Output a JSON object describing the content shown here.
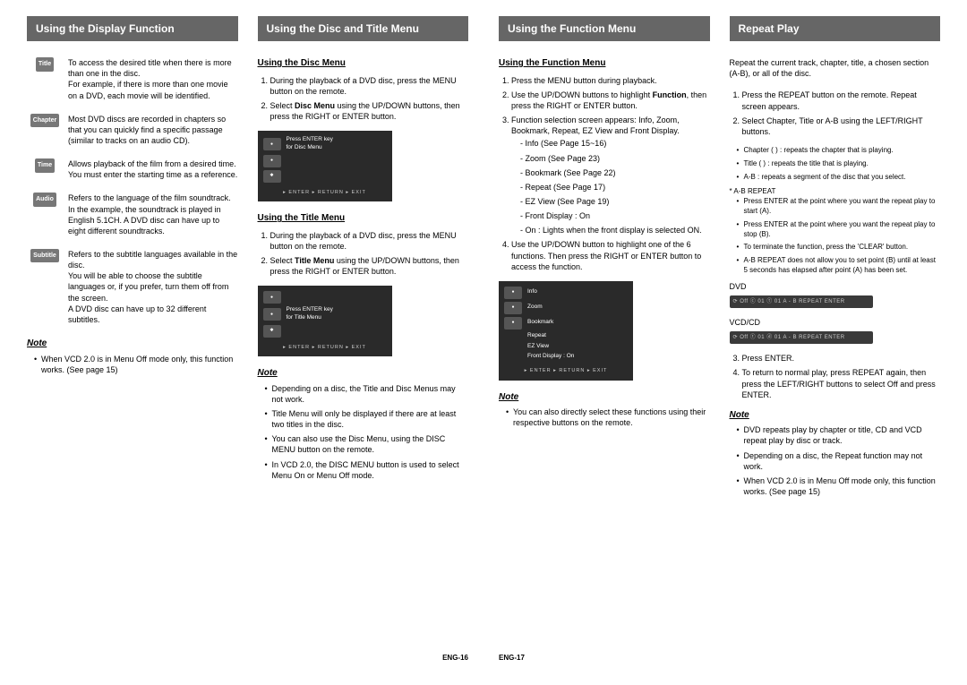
{
  "left_page": {
    "num": "ENG-16",
    "col1": {
      "title": "Using the Display Function",
      "defs": [
        {
          "icon": "Title",
          "text": "To access the desired title when there is more than one in the disc.\nFor example, if there is more than one movie on a DVD, each movie will be identified."
        },
        {
          "icon": "Chapter",
          "text": "Most DVD discs are recorded in chapters so that you can quickly find a specific passage (similar to tracks on an audio CD)."
        },
        {
          "icon": "Time",
          "text": "Allows playback of the film from a desired time. You must enter the starting time as a reference."
        },
        {
          "icon": "Audio",
          "text": "Refers to the language of the film soundtrack. In the example, the soundtrack is played in English 5.1CH. A DVD disc can have up to eight different soundtracks."
        },
        {
          "icon": "Subtitle",
          "text": "Refers to the subtitle languages available in the disc.\nYou will be able to choose the subtitle languages or, if you prefer, turn them off from the screen.\nA DVD disc can have up to 32 different subtitles."
        }
      ],
      "note_head": "Note",
      "notes": [
        "When VCD 2.0 is in Menu Off mode only, this function works. (See page 15)"
      ]
    },
    "col2": {
      "title": "Using the Disc and Title Menu",
      "disc_head": "Using the Disc Menu",
      "disc_steps": [
        "During the playback of a DVD disc, press the MENU button on the remote.",
        "Select <b>Disc Menu</b> using the UP/DOWN buttons, then press the RIGHT or ENTER button."
      ],
      "osd1_line1": "Press ENTER key",
      "osd1_line2": "for Disc Menu",
      "title_head": "Using the Title Menu",
      "title_steps": [
        "During the playback of a DVD disc, press the MENU button on the remote.",
        "Select <b>Title Menu</b> using the UP/DOWN buttons, then press the RIGHT or ENTER button."
      ],
      "osd2_line1": "Press ENTER key",
      "osd2_line2": "for Title Menu",
      "note_head": "Note",
      "notes": [
        "Depending on a disc, the Title and Disc Menus may not work.",
        "Title Menu will only be displayed if there are at least two titles in the disc.",
        "You can also use the Disc Menu, using the DISC MENU button on the remote.",
        "In VCD 2.0, the DISC MENU button is used to select Menu On or Menu Off mode."
      ],
      "osd_footer": "▸ ENTER  ▸ RETURN  ▸ EXIT"
    }
  },
  "right_page": {
    "num": "ENG-17",
    "col1": {
      "title": "Using the Function Menu",
      "sub_head": "Using the Function Menu",
      "steps_a": [
        "Press the MENU button during playback.",
        "Use the UP/DOWN buttons to highlight <b>Function</b>, then press the RIGHT or ENTER button.",
        "Function selection screen appears: Info, Zoom, Bookmark, Repeat, EZ View and Front Display."
      ],
      "dashes": [
        "Info (See Page 15~16)",
        "Zoom (See Page 23)",
        "Bookmark (See Page 22)",
        "Repeat (See Page 17)",
        "EZ View (See Page 19)",
        "Front Display : On",
        "On : Lights when the front display is selected ON."
      ],
      "steps_b": [
        "Use the UP/DOWN button to highlight one of the 6 functions. Then press the RIGHT or ENTER button to access the function."
      ],
      "osd_items": [
        "Info",
        "Zoom",
        "Bookmark",
        "Repeat",
        "EZ View",
        "Front Display : On"
      ],
      "note_head": "Note",
      "notes": [
        "You can also directly select these functions using their respective buttons on the remote."
      ],
      "osd_footer": "▸ ENTER  ▸ RETURN  ▸ EXIT"
    },
    "col2": {
      "title": "Repeat Play",
      "intro": "Repeat the current track, chapter, title, a chosen section (A-B), or all of the disc.",
      "steps": [
        "Press the REPEAT button on the remote. Repeat screen appears.",
        "Select Chapter, Title or A-B using the LEFT/RIGHT buttons."
      ],
      "sub_bullets": [
        "Chapter (  ) : repeats the chapter that is playing.",
        "Title (  ) : repeats the title that is playing.",
        "A-B : repeats a segment of the disc that you select."
      ],
      "ab_head": "* A-B REPEAT",
      "ab_bullets": [
        "Press ENTER at the point where you want the repeat play to start (A).",
        "Press ENTER at the point where you want the repeat play to stop (B).",
        "To terminate the function, press the 'CLEAR' button.",
        "A-B REPEAT does not allow you to set point (B) until at least 5 seconds has elapsed after point (A) has been set."
      ],
      "dvd_label": "DVD",
      "dvd_bar": "⟳ Off  ⓒ 01  ⓣ 01  A - B   REPEAT  ENTER",
      "vcd_label": "VCD/CD",
      "vcd_bar": "⟳ Off  ⓣ 01  ⓓ 01  A - B   REPEAT  ENTER",
      "steps2": [
        "Press ENTER.",
        "To return to normal play, press REPEAT again, then press the LEFT/RIGHT buttons to select Off and press ENTER."
      ],
      "note_head": "Note",
      "notes": [
        "DVD repeats play by chapter or title, CD and VCD repeat play by disc or track.",
        "Depending on a disc, the Repeat function may not work.",
        "When VCD 2.0 is in Menu Off mode only, this function works. (See page 15)"
      ]
    }
  }
}
